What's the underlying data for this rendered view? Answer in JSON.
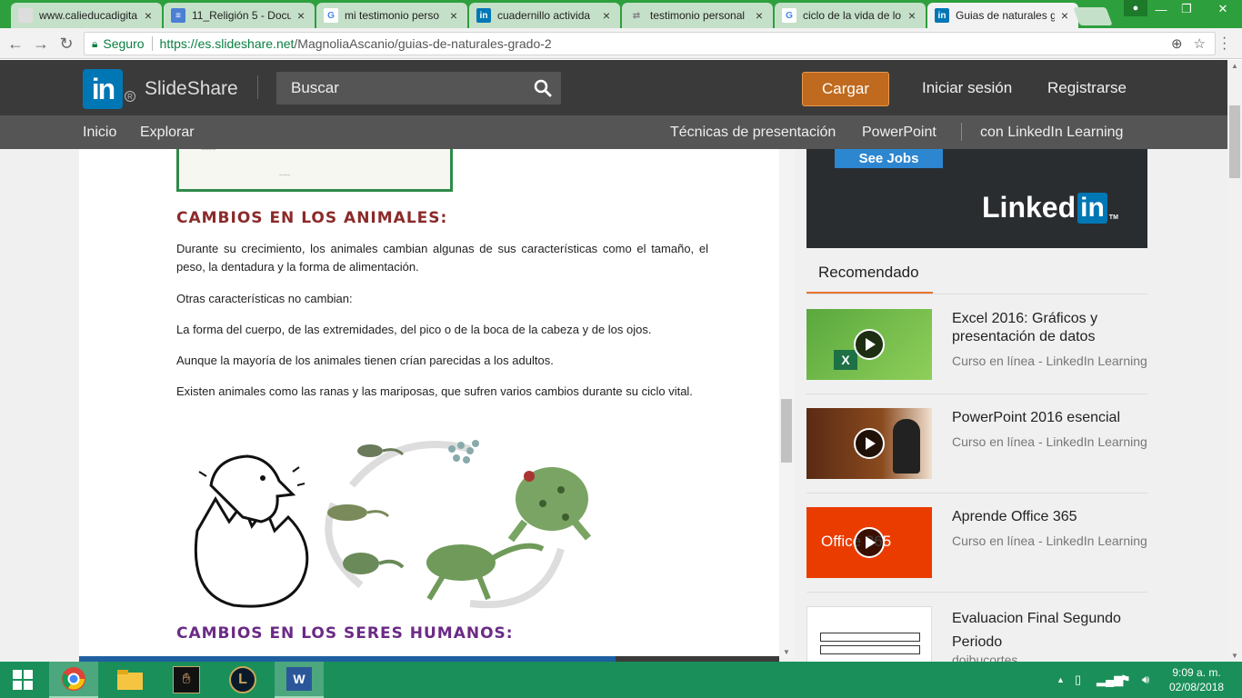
{
  "browser": {
    "tabs": [
      {
        "title": "www.calieducadigita",
        "favicon": "page-icon",
        "color": "#999999"
      },
      {
        "title": "11_Religión 5 - Docu",
        "favicon": "docs-icon",
        "color": "#4a7fd4"
      },
      {
        "title": "mi testimonio perso",
        "favicon": "google-icon",
        "color": "#ffffff"
      },
      {
        "title": "cuadernillo activida",
        "favicon": "linkedin-icon",
        "color": "#0077b5"
      },
      {
        "title": "testimonio personal",
        "favicon": "arrows-icon",
        "color": "#aaaaaa"
      },
      {
        "title": "ciclo de la vida de lo",
        "favicon": "google-icon",
        "color": "#ffffff"
      },
      {
        "title": "Guias de naturales g",
        "favicon": "linkedin-icon",
        "color": "#0077b5"
      }
    ],
    "tab_close": "×",
    "address": {
      "secure_label": "Seguro",
      "url_host": "https://es.slideshare.net",
      "url_path": "/MagnoliaAscanio/guias-de-naturales-grado-2"
    }
  },
  "header": {
    "logo": "in",
    "brand": "SlideShare",
    "search_placeholder": "Buscar",
    "upload": "Cargar",
    "login": "Iniciar sesión",
    "register": "Registrarse"
  },
  "subnav": {
    "home": "Inicio",
    "explore": "Explorar",
    "presentation_tips": "Técnicas de presentación",
    "powerpoint": "PowerPoint",
    "linkedin_learning": "con LinkedIn Learning"
  },
  "document": {
    "heading_animals": "CAMBIOS EN LOS ANIMALES:",
    "p1": "Durante su crecimiento, los animales cambian algunas de sus características como  el  tamaño, el peso, la dentadura y la forma de alimentación.",
    "p2": "Otras características no cambian:",
    "p3": "La forma  del cuerpo, de las extremidades, del pico o de la boca de la cabeza y de los  ojos.",
    "p4": "Aunque la mayoría de los animales tienen crían parecidas a los adultos.",
    "p5": "Existen  animales como  las  ranas y las  mariposas, que  sufren varios cambios  durante su  ciclo vital.",
    "heading_humans": "CAMBIOS EN LOS  SERES  HUMANOS:"
  },
  "ad": {
    "button": "See Jobs",
    "logo_text": "Linked",
    "logo_in": "in"
  },
  "recommended": {
    "tab": "Recomendado",
    "items": [
      {
        "title": "Excel 2016: Gráficos y presentación de datos",
        "subtitle": "Curso en línea - LinkedIn Learning"
      },
      {
        "title": "PowerPoint 2016 esencial",
        "subtitle": "Curso en línea - LinkedIn Learning"
      },
      {
        "title": "Aprende Office 365",
        "subtitle": "Curso en línea - LinkedIn Learning",
        "thumb_text": "Office 365"
      },
      {
        "title": "Evaluacion Final Segundo Periodo",
        "subtitle": "doibucortes"
      }
    ]
  },
  "taskbar": {
    "time": "9:09 a. m.",
    "date": "02/08/2018"
  },
  "colors": {
    "tabstrip": "#2d9f3c",
    "linkedin_blue": "#0077b5",
    "upload_orange": "#bf6a1e",
    "accent_orange": "#e5742e",
    "heading_red": "#8b2a2a",
    "heading_purple": "#6b2a86",
    "taskbar": "#1a8f5a"
  }
}
